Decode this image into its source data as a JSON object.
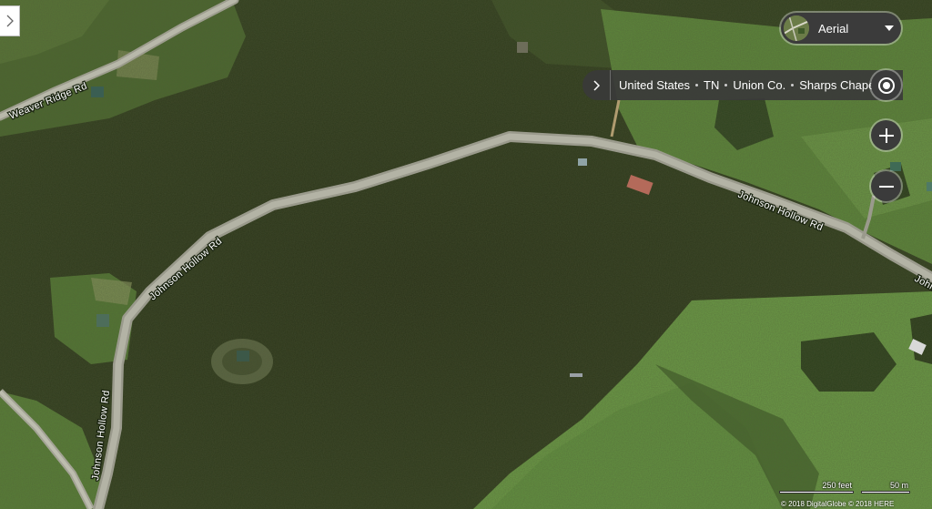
{
  "map": {
    "road_labels": {
      "weaver_ridge": "Weaver Ridge Rd",
      "johnson_hollow_left": "Johnson Hollow Rd",
      "johnson_hollow_mid": "Johnson Hollow Rd",
      "johnson_hollow_right": "Johnson Hollow Rd",
      "johnson_hollow_edge": "Johns"
    }
  },
  "controls": {
    "map_type": {
      "label": "Aerial",
      "icon": "aerial-thumbnail-icon"
    },
    "breadcrumb": {
      "items": [
        "United States",
        "TN",
        "Union Co.",
        "Sharps Chapel"
      ]
    },
    "locate_icon": "locate-me-icon",
    "zoom_in_icon": "plus-icon",
    "zoom_out_icon": "minus-icon"
  },
  "scale": {
    "feet": "250 feet",
    "meters": "50 m"
  },
  "copyright": "© 2018 DigitalGlobe © 2018 HERE",
  "colors": {
    "forest_dark": "#27331a",
    "field_green": "#5f8a3c",
    "road": "#a9a99c",
    "control_bg": "#3b3b3b"
  }
}
